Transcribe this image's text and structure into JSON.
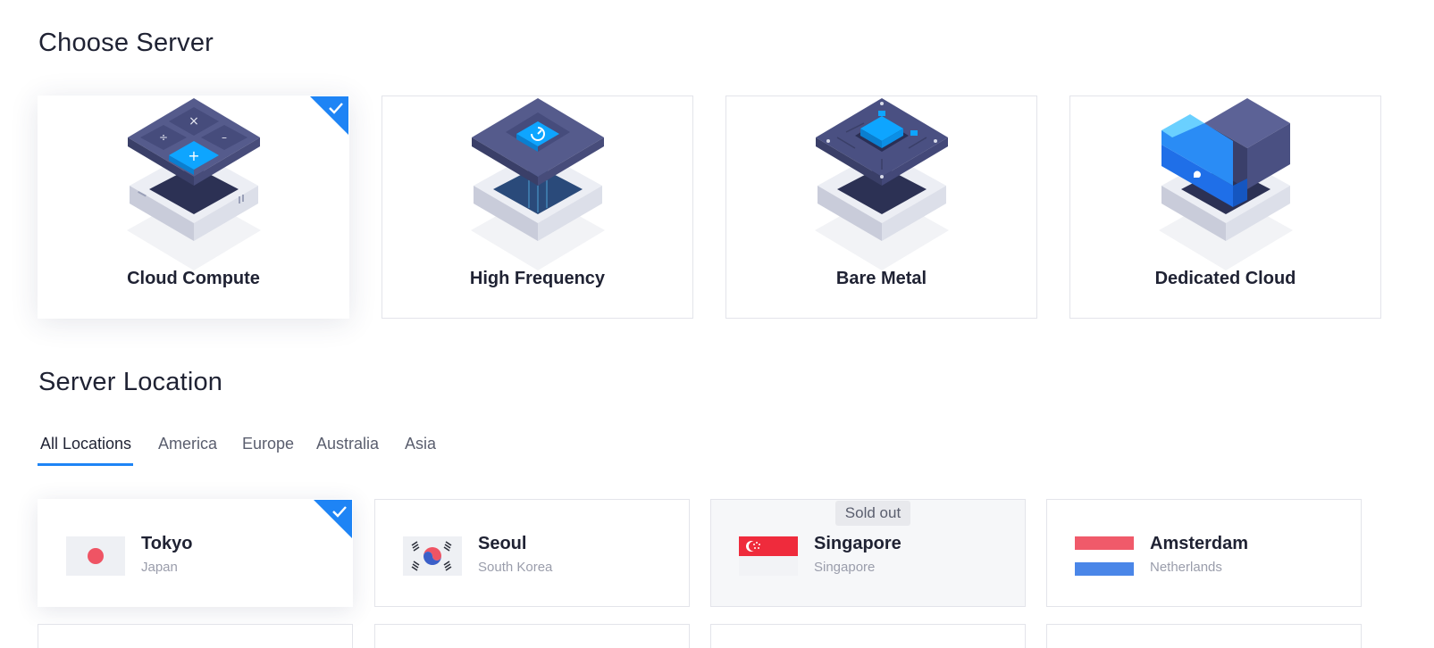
{
  "sections": {
    "server_title": "Choose Server",
    "location_title": "Server Location"
  },
  "servers": [
    {
      "label": "Cloud Compute",
      "selected": true,
      "icon": "calculator-server-icon"
    },
    {
      "label": "High Frequency",
      "selected": false,
      "icon": "speed-gauge-server-icon"
    },
    {
      "label": "Bare Metal",
      "selected": false,
      "icon": "chip-server-icon"
    },
    {
      "label": "Dedicated Cloud",
      "selected": false,
      "icon": "block-server-icon"
    }
  ],
  "tabs": [
    {
      "label": "All Locations",
      "active": true
    },
    {
      "label": "America",
      "active": false
    },
    {
      "label": "Europe",
      "active": false
    },
    {
      "label": "Australia",
      "active": false
    },
    {
      "label": "Asia",
      "active": false
    }
  ],
  "locations": [
    {
      "city": "Tokyo",
      "country": "Japan",
      "selected": true,
      "sold_out": false,
      "flag": "japan-flag-icon"
    },
    {
      "city": "Seoul",
      "country": "South Korea",
      "selected": false,
      "sold_out": false,
      "flag": "south-korea-flag-icon"
    },
    {
      "city": "Singapore",
      "country": "Singapore",
      "selected": false,
      "sold_out": true,
      "badge": "Sold out",
      "flag": "singapore-flag-icon"
    },
    {
      "city": "Amsterdam",
      "country": "Netherlands",
      "selected": false,
      "sold_out": false,
      "flag": "netherlands-flag-icon"
    }
  ],
  "colors": {
    "accent": "#1e84f5",
    "text": "#1f2233",
    "muted": "#9a9dab",
    "border": "#e3e4ea",
    "server_dark": "#3d4270",
    "server_blue": "#0ea5ff"
  }
}
